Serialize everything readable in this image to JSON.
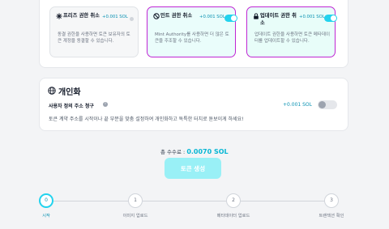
{
  "authority_cards": [
    {
      "title": "프리즈 권한 취소",
      "price": "+0.001 SOL",
      "desc": "동결 권한을 사용하면 토큰 보유자의 토큰 계정을 동결할 수 있습니다.",
      "enabled": false
    },
    {
      "title": "민트 권한 취소",
      "price": "+0.001 SOL",
      "desc": "Mint Authority를 사용하면 더 많은 토큰을 주조할 수 있습니다.",
      "enabled": true
    },
    {
      "title": "업데이트 권한 취소",
      "price": "+0.001 SOL",
      "desc": "업데이트 권한을 사용하면 토큰 메타데이터를 업데이트할 수 있습니다.",
      "enabled": true
    }
  ],
  "personalization": {
    "title": "개인화",
    "custom_address_label": "사용자 정의 주소 청구",
    "info_icon": "i",
    "price": "+0.001 SOL",
    "enabled": false,
    "description": "토큰 계약 주소를 시작이나 끝 부분을 맞춤 설정하여 개인화하고 독특한 터치로 돋보이게 하세요!"
  },
  "total": {
    "label": "총 수수료 : ",
    "value": "0.0070 SOL"
  },
  "create_button": "토큰 생성",
  "steps": [
    {
      "num": "0",
      "label": "시작",
      "active": true
    },
    {
      "num": "1",
      "label": "이미지 업로드",
      "active": false
    },
    {
      "num": "2",
      "label": "메타데이터 업로드",
      "active": false
    },
    {
      "num": "3",
      "label": "트랜잭션 확인",
      "active": false
    }
  ],
  "colors": {
    "accent": "#22d3ee",
    "price": "#0891b2",
    "card_border": "#c026d3",
    "button": "#99f0f6"
  },
  "icons": [
    "snowflake-icon",
    "ban-icon",
    "lock-icon",
    "globe-icon",
    "info-icon"
  ]
}
